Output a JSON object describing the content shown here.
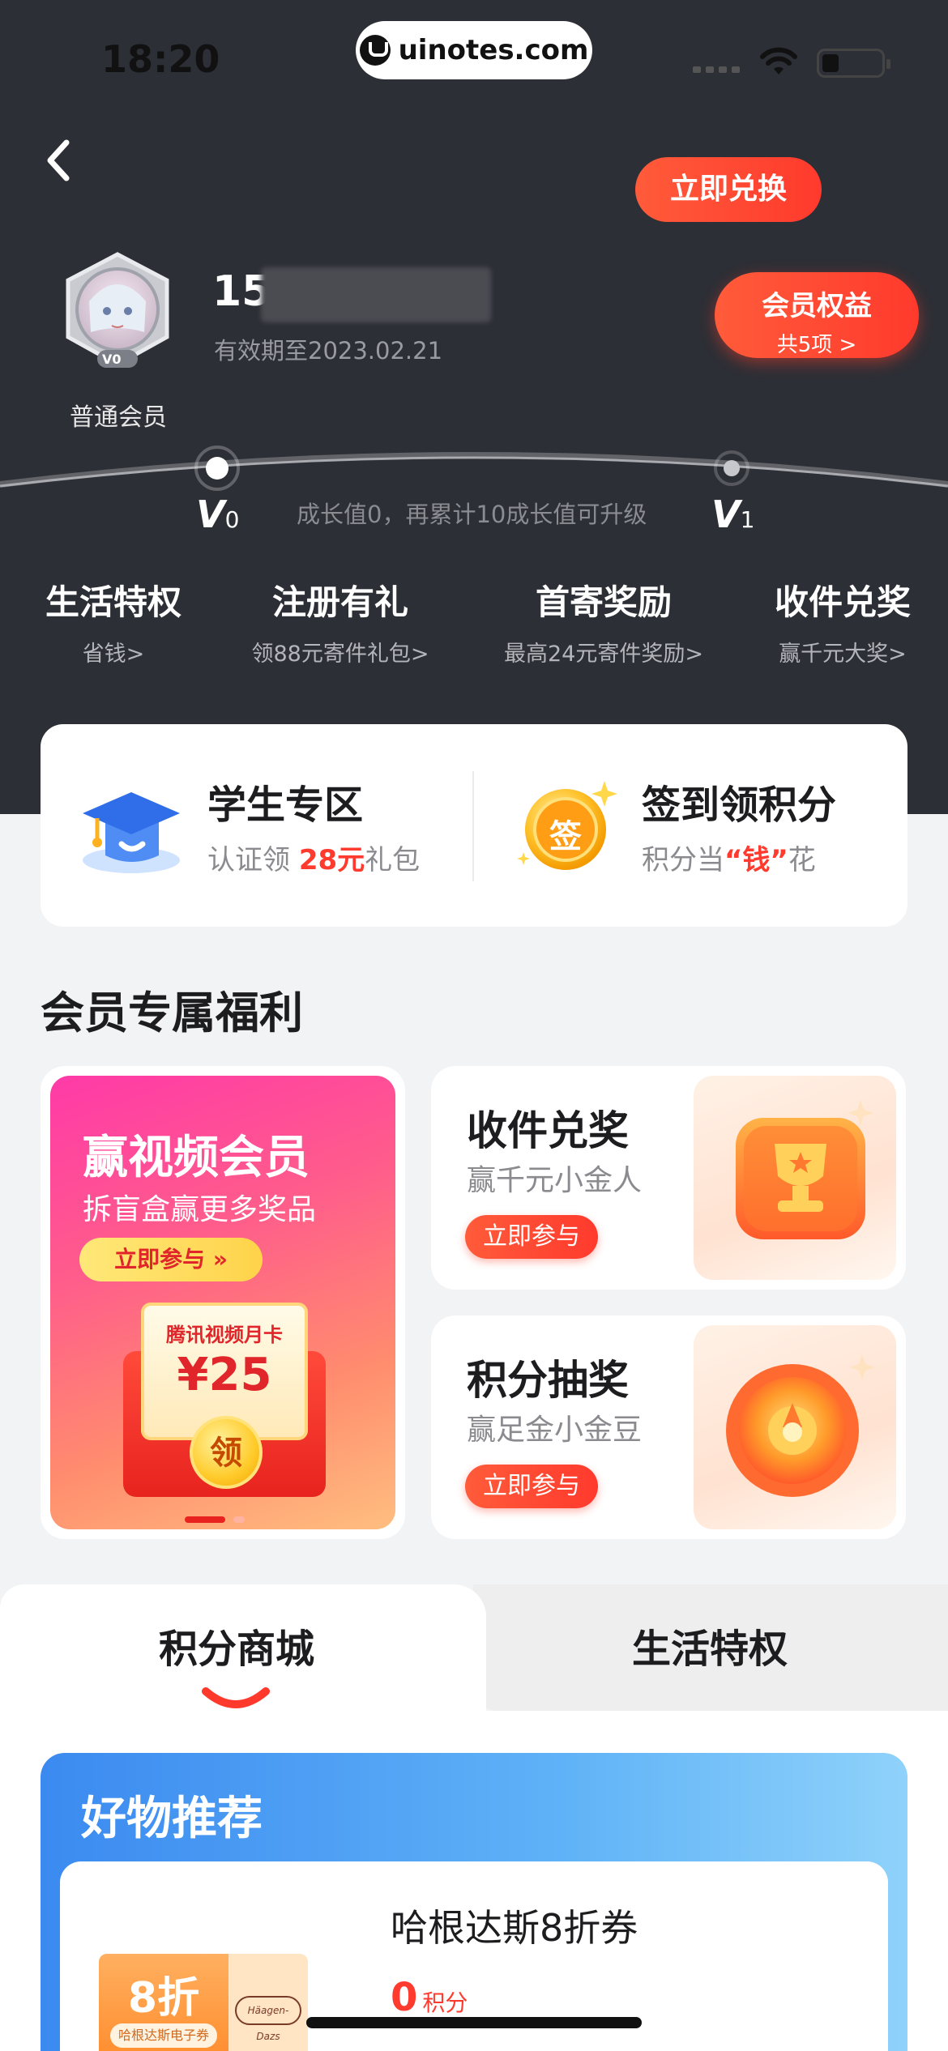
{
  "status_bar": {
    "time": "18:20",
    "url": "uinotes.com"
  },
  "profile": {
    "member_type": "普通会员",
    "badge_level": "V0",
    "phone_prefix": "15",
    "validity": "有效期至2023.02.21",
    "rights_button": {
      "title": "会员权益",
      "subtitle": "共5项 >"
    }
  },
  "level": {
    "current": {
      "letter": "V",
      "number": "0"
    },
    "next": {
      "letter": "V",
      "number": "1"
    },
    "note": "成长值0，再累计10成长值可升级",
    "progress": 0
  },
  "privileges": [
    {
      "title": "生活特权",
      "subtitle": "省钱>"
    },
    {
      "title": "注册有礼",
      "subtitle": "领88元寄件礼包>"
    },
    {
      "title": "首寄奖励",
      "subtitle": "最高24元寄件奖励>"
    },
    {
      "title": "收件兑奖",
      "subtitle": "赢千元大奖>"
    }
  ],
  "quick_entries": {
    "student": {
      "title": "学生专区",
      "sub_prefix": "认证领 ",
      "sub_highlight": "28元",
      "sub_suffix": "礼包",
      "icon": "graduation-cap-icon"
    },
    "checkin": {
      "title": "签到领积分",
      "sub_prefix": "积分当",
      "sub_highlight": "“钱”",
      "sub_suffix": "花",
      "coin_text": "签",
      "icon": "checkin-coin-icon"
    }
  },
  "benefits": {
    "section_title": "会员专属福利",
    "video_card": {
      "title": "赢视频会员",
      "subtitle": "拆盲盒赢更多奖品",
      "button": "立即参与 »",
      "envelope_title": "腾讯视频月卡",
      "envelope_value": "¥25",
      "coin_text": "领"
    },
    "cards": [
      {
        "title": "收件兑奖",
        "subtitle": "赢千元小金人",
        "button": "立即参与",
        "icon": "trophy-icon"
      },
      {
        "title": "积分抽奖",
        "subtitle": "赢足金小金豆",
        "button": "立即参与",
        "icon": "lucky-wheel-icon"
      }
    ]
  },
  "tabs": [
    {
      "label": "积分商城",
      "active": true
    },
    {
      "label": "生活特权",
      "active": false
    }
  ],
  "mall": {
    "section_title": "好物推荐",
    "item": {
      "coupon_big": "8折",
      "coupon_tag": "哈根达斯电子券",
      "coupon_brand": "Häagen-Dazs",
      "title": "哈根达斯8折券",
      "points_value": "0",
      "points_unit": "积分",
      "button": "立即兑换"
    }
  },
  "colors": {
    "accent": "#ff3a2d",
    "hero_bg": "#2d2f36",
    "page_bg": "#f2f3f5"
  }
}
